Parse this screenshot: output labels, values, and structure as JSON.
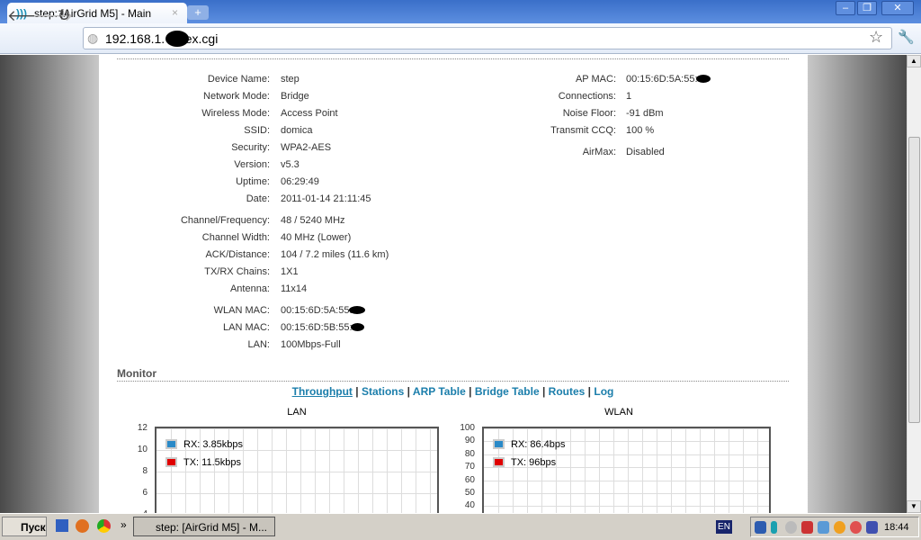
{
  "browser": {
    "tab_title": "step: [AirGrid M5] - Main",
    "url": "192.168.1.   index.cgi"
  },
  "status": {
    "left": [
      {
        "label": "Device Name:",
        "value": "step"
      },
      {
        "label": "Network Mode:",
        "value": "Bridge"
      },
      {
        "label": "Wireless Mode:",
        "value": "Access Point"
      },
      {
        "label": "SSID:",
        "value": "domica"
      },
      {
        "label": "Security:",
        "value": "WPA2-AES"
      },
      {
        "label": "Version:",
        "value": "v5.3"
      },
      {
        "label": "Uptime:",
        "value": "06:29:49"
      },
      {
        "label": "Date:",
        "value": "2011-01-14 21:11:45"
      },
      {
        "label": "Channel/Frequency:",
        "value": "48 / 5240 MHz"
      },
      {
        "label": "Channel Width:",
        "value": "40 MHz (Lower)"
      },
      {
        "label": "ACK/Distance:",
        "value": "104 / 7.2 miles (11.6 km)"
      },
      {
        "label": "TX/RX Chains:",
        "value": "1X1"
      },
      {
        "label": "Antenna:",
        "value": "11x14"
      },
      {
        "label": "WLAN MAC:",
        "value": "00:15:6D:5A:55:"
      },
      {
        "label": "LAN MAC:",
        "value": "00:15:6D:5B:55:"
      },
      {
        "label": "LAN:",
        "value": "100Mbps-Full"
      }
    ],
    "right": [
      {
        "label": "AP MAC:",
        "value": "00:15:6D:5A:55:"
      },
      {
        "label": "Connections:",
        "value": "1"
      },
      {
        "label": "Noise Floor:",
        "value": "-91 dBm"
      },
      {
        "label": "Transmit CCQ:",
        "value": "100 %"
      },
      {
        "label": "AirMax:",
        "value": "Disabled"
      }
    ]
  },
  "monitor": {
    "title": "Monitor",
    "links": [
      "Throughput",
      "Stations",
      "ARP Table",
      "Bridge Table",
      "Routes",
      "Log"
    ],
    "active": "Throughput"
  },
  "chart_data": [
    {
      "type": "line",
      "title": "LAN",
      "yticks": [
        12,
        10,
        8,
        6,
        4
      ],
      "ylim": [
        0,
        12
      ],
      "legend": [
        {
          "label": "RX: 3.85kbps",
          "color": "#2a8ac8"
        },
        {
          "label": "TX: 11.5kbps",
          "color": "#e00000"
        }
      ]
    },
    {
      "type": "line",
      "title": "WLAN",
      "yticks": [
        100,
        90,
        80,
        70,
        60,
        50,
        40
      ],
      "ylim": [
        0,
        100
      ],
      "legend": [
        {
          "label": "RX: 86.4bps",
          "color": "#2a8ac8"
        },
        {
          "label": "TX: 96bps",
          "color": "#e00000"
        }
      ]
    }
  ],
  "taskbar": {
    "start": "Пуск",
    "task": "step: [AirGrid M5] - M...",
    "lang": "EN",
    "clock": "18:44"
  }
}
